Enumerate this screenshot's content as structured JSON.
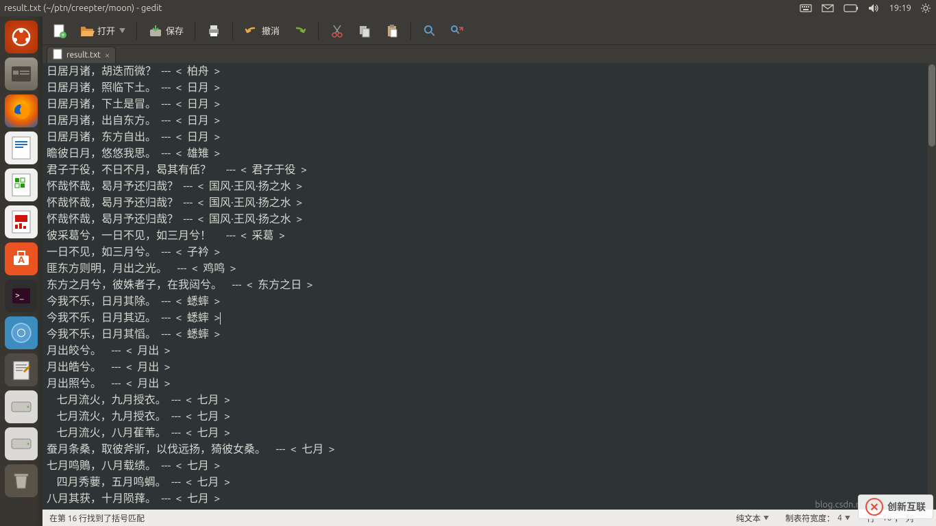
{
  "menubar": {
    "title": "result.txt (~/ptn/creepter/moon) - gedit",
    "time": "19:19"
  },
  "toolbar": {
    "open": "打开",
    "save": "保存",
    "undo": "撤消"
  },
  "tab": {
    "filename": "result.txt"
  },
  "editor": {
    "lines": [
      "日居月诸，胡迭而微？  ---  <  柏舟  >",
      "日居月诸，照临下土。  ---  <  日月  >",
      "日居月诸，下土是冒。  ---  <  日月  >",
      "日居月诸，出自东方。  ---  <  日月  >",
      "日居月诸，东方自出。  ---  <  日月  >",
      "瞻彼日月，悠悠我思。  ---  <  雄雉  >",
      "君子于役，不日不月，曷其有佸？      ---  <  君子于役  >",
      "怀哉怀哉，曷月予还归哉？  ---  <  国风·王风·扬之水  >",
      "怀哉怀哉，曷月予还归哉？  ---  <  国风·王风·扬之水  >",
      "怀哉怀哉，曷月予还归哉？  ---  <  国风·王风·扬之水  >",
      "彼采葛兮，一日不见，如三月兮！      ---  <  采葛  >",
      "一日不见，如三月兮。  ---  <  子衿  >",
      "匪东方则明，月出之光。    ---  <  鸡鸣  >",
      "东方之月兮，彼姝者子，在我闼兮。    ---  <  东方之日  >",
      "今我不乐，日月其除。  ---  <  蟋蟀  >",
      "今我不乐，日月其迈。  ---  <  蟋蟀  >",
      "今我不乐，日月其慆。  ---  <  蟋蟀  >",
      "月出皎兮。    ---  <  月出  >",
      "月出皓兮。    ---  <  月出  >",
      "月出照兮。    ---  <  月出  >",
      "    七月流火，九月授衣。  ---  <  七月  >",
      "    七月流火，九月授衣。  ---  <  七月  >",
      "    七月流火，八月萑苇。  ---  <  七月  >",
      "蚕月条桑，取彼斧斨，以伐远扬，猗彼女桑。    ---  <  七月  >",
      "七月鸣鵙，八月载绩。  ---  <  七月  >",
      "    四月秀葽，五月鸣蜩。  ---  <  七月  >",
      "八月其获，十月陨萚。  ---  <  七月  >"
    ],
    "cursor_line": 15
  },
  "statusbar": {
    "message": "在第 16 行找到了括号匹配",
    "syntax": "纯文本",
    "tabwidth_label": "制表符宽度：",
    "tabwidth_value": "4",
    "line_label": "行",
    "line_value": "16",
    "col_label": "列",
    "col_value": ""
  },
  "watermark": {
    "text": "创新互联",
    "url": "blog.csdn.n"
  }
}
